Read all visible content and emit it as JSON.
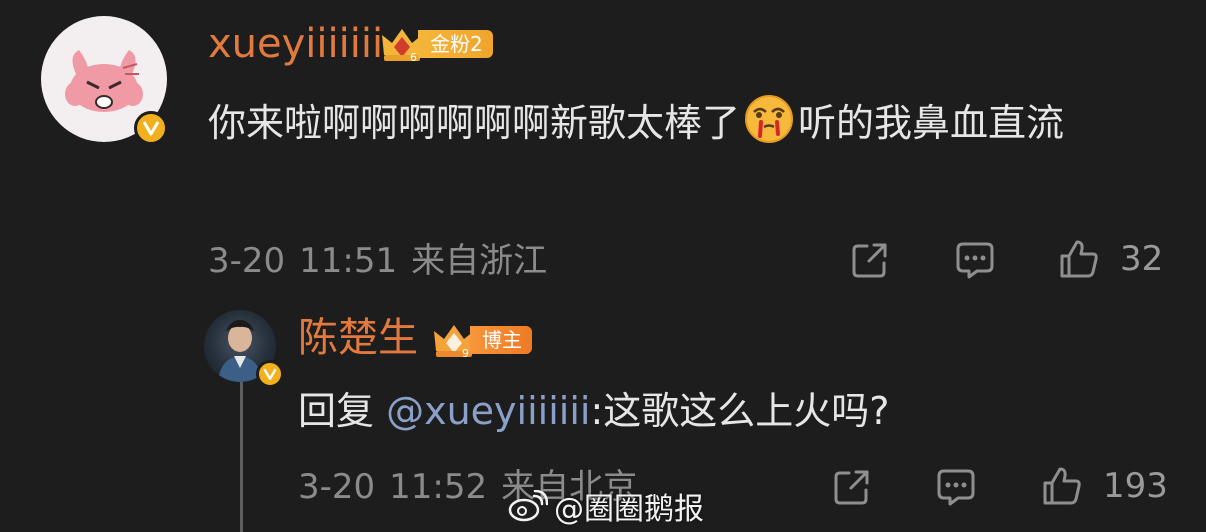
{
  "comment": {
    "username": "xueyiiiiiii",
    "badge": {
      "level": "6",
      "label": "金粉2"
    },
    "text_before_emoji": "你来啦啊啊啊啊啊啊新歌太棒了",
    "emoji": "nosebleed-emoji",
    "text_after_emoji": "听的我鼻血直流",
    "date": "3-20",
    "time": "11:51",
    "location": "来自浙江",
    "like_count": "32"
  },
  "reply": {
    "username": "陈楚生",
    "badge": {
      "level": "9",
      "label": "博主"
    },
    "prefix": "回复 ",
    "mention": "@xueyiiiiiii",
    "text": ":这歌这么上火吗?",
    "date": "3-20",
    "time": "11:52",
    "location": "来自北京",
    "like_count": "193"
  },
  "watermark": {
    "text": "@圈圈鹅报",
    "icon": "weibo-logo"
  },
  "icons": {
    "share": "share-icon",
    "comment": "comment-icon",
    "like": "thumbs-up-icon",
    "verified": "verified-v-icon"
  },
  "colors": {
    "background": "#1d1d1d",
    "username": "#e27a3f",
    "mention": "#8aa0c8",
    "meta": "#8b8b8b",
    "verified": "#f2b01e"
  }
}
